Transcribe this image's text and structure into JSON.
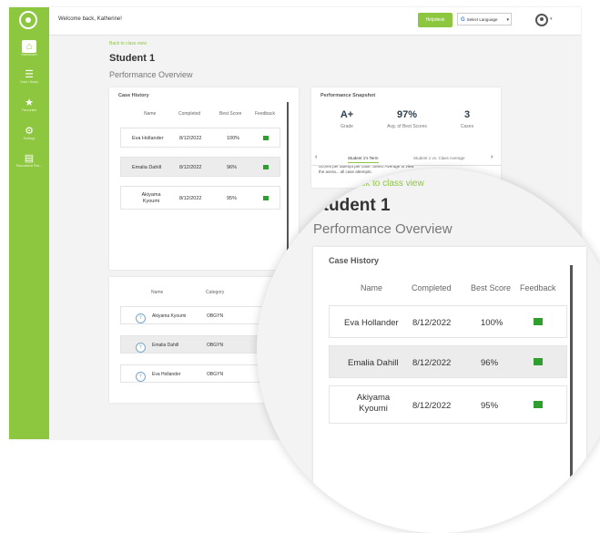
{
  "topbar": {
    "welcome": "Welcome back, Katherine!",
    "helpdesk": "Helpdesk",
    "language": "Select Language"
  },
  "sidebar": {
    "items": [
      {
        "label": "Dashboard",
        "icon": "home-icon"
      },
      {
        "label": "Case Library",
        "icon": "list-icon"
      },
      {
        "label": "Favourites",
        "icon": "star-icon"
      },
      {
        "label": "Settings",
        "icon": "gear-icon"
      },
      {
        "label": "Educational Res...",
        "icon": "book-icon"
      }
    ]
  },
  "page": {
    "back_link": "Back to class view",
    "title": "Student 1",
    "subtitle": "Performance Overview"
  },
  "case_history": {
    "title": "Case History",
    "columns": [
      "Name",
      "Completed",
      "Best Score",
      "Feedback"
    ],
    "rows": [
      {
        "name": "Eva Hollander",
        "completed": "8/12/2022",
        "score": "100%"
      },
      {
        "name": "Emalia Dahill",
        "completed": "8/12/2022",
        "score": "96%"
      },
      {
        "name": "Akiyama Kyoumi",
        "completed": "8/12/2022",
        "score": "95%"
      }
    ]
  },
  "snapshot": {
    "title": "Performance Snapshot",
    "grade": "A+",
    "grade_label": "Grade",
    "avg": "97%",
    "avg_label": "Avg. of Best Scores",
    "cases": "3",
    "cases_label": "Cases",
    "tab1": "Student 1's Term",
    "tab2": "Student 1 vs. Class Average",
    "desc": "Scores per attempt per case. Select Average to view the avera... all case attempts.",
    "prev": "‹",
    "next": "›"
  },
  "cases_list": {
    "columns": [
      "Name",
      "Category"
    ],
    "rows": [
      {
        "name": "Akiyama Kyoumi",
        "category": "OBGYN"
      },
      {
        "name": "Emalia Dahill",
        "category": "OBGYN"
      },
      {
        "name": "Eva Hollander",
        "category": "OBGYN"
      }
    ]
  },
  "colors": {
    "accent": "#8dc63f",
    "flag": "#2e9e2e"
  }
}
